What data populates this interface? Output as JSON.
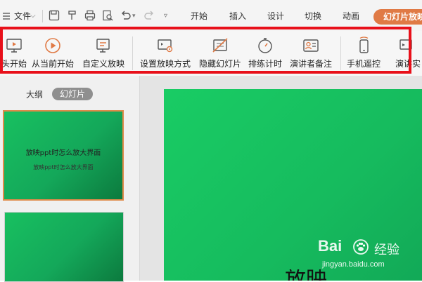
{
  "menubar": {
    "file_label": "文件",
    "tabs": [
      "开始",
      "插入",
      "设计",
      "切换",
      "动画"
    ],
    "active_tab": "幻灯片放映"
  },
  "ribbon": {
    "buttons": [
      {
        "label": "头开始",
        "icon": "screen-play-icon"
      },
      {
        "label": "从当前开始",
        "icon": "play-circle-icon"
      },
      {
        "label": "自定义放映",
        "icon": "custom-show-icon"
      },
      {
        "label": "设置放映方式",
        "icon": "show-settings-icon"
      },
      {
        "label": "隐藏幻灯片",
        "icon": "hide-slide-icon"
      },
      {
        "label": "排练计时",
        "icon": "stopwatch-icon"
      },
      {
        "label": "演讲者备注",
        "icon": "speaker-notes-icon"
      },
      {
        "label": "手机遥控",
        "icon": "phone-remote-icon"
      },
      {
        "label": "演讲实",
        "icon": "presenter-icon"
      }
    ]
  },
  "leftpane": {
    "tab_outline": "大纲",
    "tab_slides": "幻灯片",
    "thumb1_title": "放映ppt时怎么放大界面",
    "thumb1_subtitle": "放映ppt时怎么放大界面"
  },
  "slide": {
    "visible_text": "放映"
  },
  "watermark": {
    "brand": "Bai",
    "brand_suffix": "经验",
    "url": "jingyan.baidu.com"
  },
  "colors": {
    "accent_tab": "#e07a45",
    "highlight": "#e8101a",
    "slide_green": "#19cc64"
  }
}
